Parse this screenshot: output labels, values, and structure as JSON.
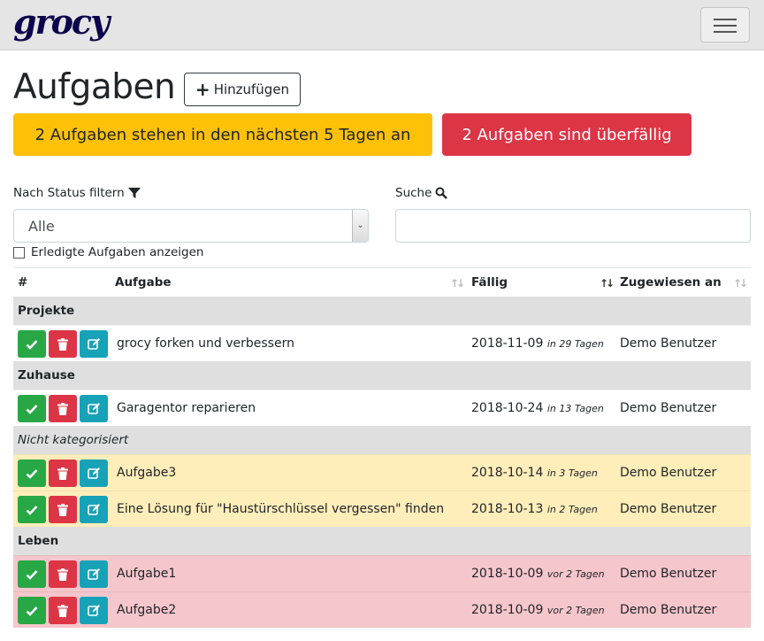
{
  "navbar": {
    "brand": "grocy"
  },
  "header": {
    "title": "Aufgaben",
    "add_button": "Hinzufügen"
  },
  "alerts": {
    "due_soon": "2 Aufgaben stehen in den nächsten 5 Tagen an",
    "overdue": "2 Aufgaben sind überfällig"
  },
  "filters": {
    "status_label": "Nach Status filtern",
    "status_value": "Alle",
    "search_label": "Suche",
    "search_value": "",
    "show_done_label": "Erledigte Aufgaben anzeigen"
  },
  "table": {
    "headers": {
      "num": "#",
      "task": "Aufgabe",
      "due": "Fällig",
      "assigned": "Zugewiesen an"
    },
    "groups": [
      {
        "name": "Projekte",
        "rows": [
          {
            "name": "grocy forken und verbessern",
            "due": "2018-11-09",
            "relative": "in 29 Tagen",
            "assigned": "Demo Benutzer"
          }
        ]
      },
      {
        "name": "Zuhause",
        "rows": [
          {
            "name": "Garagentor reparieren",
            "due": "2018-10-24",
            "relative": "in 13 Tagen",
            "assigned": "Demo Benutzer"
          }
        ]
      },
      {
        "name": "Nicht kategorisiert",
        "rows": [
          {
            "name": "Aufgabe3",
            "due": "2018-10-14",
            "relative": "in 3 Tagen",
            "assigned": "Demo Benutzer"
          },
          {
            "name": "Eine Lösung für \"Haustürschlüssel vergessen\" finden",
            "due": "2018-10-13",
            "relative": "in 2 Tagen",
            "assigned": "Demo Benutzer"
          }
        ]
      },
      {
        "name": "Leben",
        "rows": [
          {
            "name": "Aufgabe1",
            "due": "2018-10-09",
            "relative": "vor 2 Tagen",
            "assigned": "Demo Benutzer"
          },
          {
            "name": "Aufgabe2",
            "due": "2018-10-09",
            "relative": "vor 2 Tagen",
            "assigned": "Demo Benutzer"
          }
        ]
      }
    ]
  },
  "icons": {
    "menu": "hamburger-icon",
    "add": "plus-icon",
    "filter": "filter-icon",
    "search": "search-icon",
    "track": "check-icon",
    "delete": "trash-icon",
    "edit": "edit-icon"
  },
  "colors": {
    "warning": "#ffc107",
    "danger": "#dc3545",
    "success": "#28a745",
    "info": "#17a2b8",
    "row_warning": "#ffeeba",
    "row_danger": "#f5c6cb",
    "brand": "#0b024c"
  }
}
